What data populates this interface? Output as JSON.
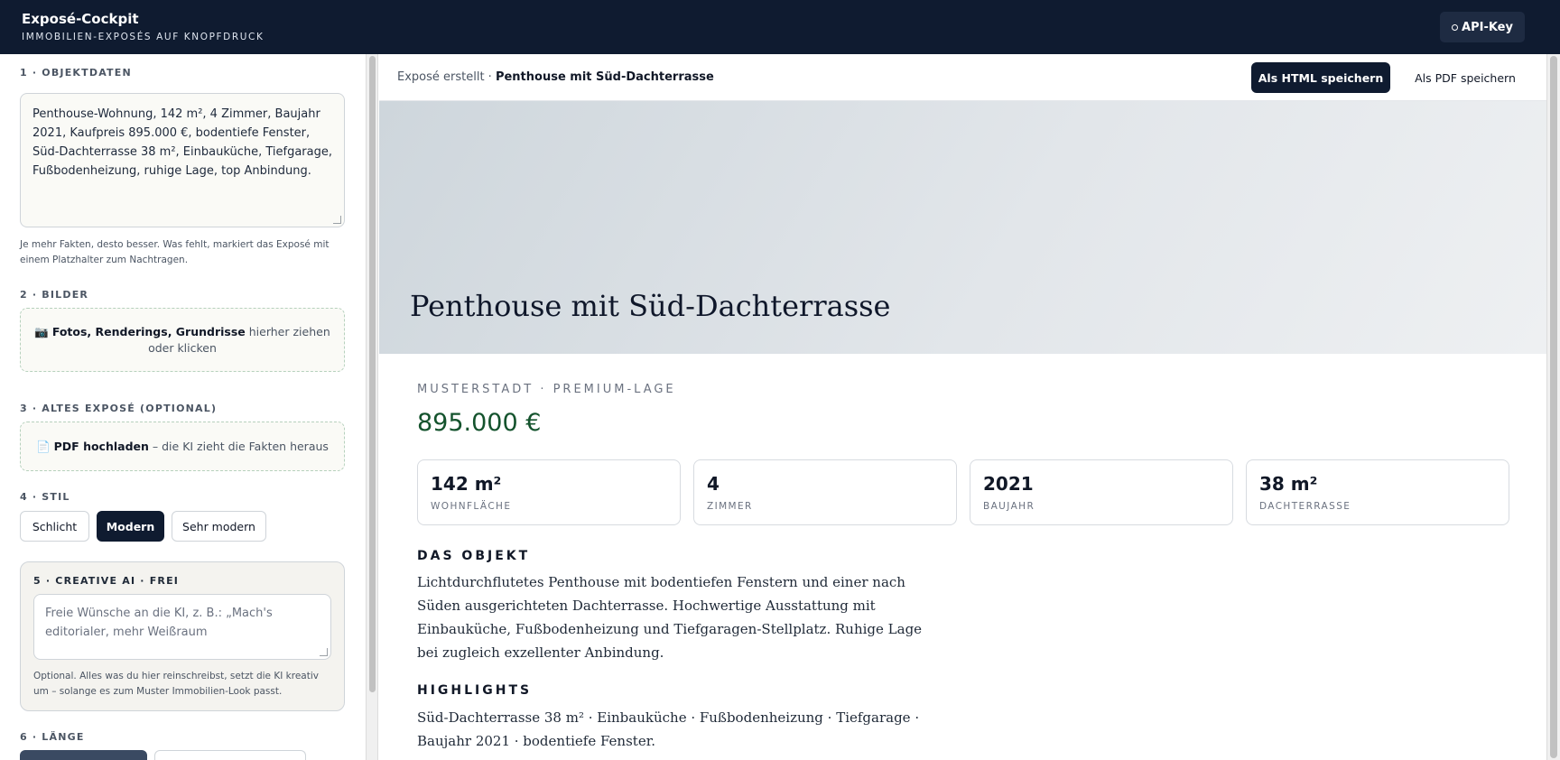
{
  "header": {
    "title": "Exposé-Cockpit",
    "subtitle": "IMMOBILIEN-EXPOSÉS AUF KNOPFDRUCK",
    "api_key_label": "API-Key"
  },
  "sidebar": {
    "section1": {
      "label": "1 · OBJEKTDATEN",
      "value": "Penthouse-Wohnung, 142 m², 4 Zimmer, Baujahr 2021, Kaufpreis 895.000 €, bodentiefe Fenster, Süd-Dachterrasse 38 m², Einbauküche, Tiefgarage, Fußbodenheizung, ruhige Lage, top Anbindung.",
      "hint": "Je mehr Fakten, desto besser. Was fehlt, markiert das Exposé mit einem Platzhalter zum Nachtragen."
    },
    "section2": {
      "label": "2 · BILDER",
      "drop_strong": "Fotos, Renderings, Grundrisse",
      "drop_rest": " hierher ziehen oder klicken"
    },
    "section3": {
      "label": "3 · ALTES EXPOSÉ (OPTIONAL)",
      "drop_strong": "PDF hochladen",
      "drop_rest": " – die KI zieht die Fakten heraus"
    },
    "section4": {
      "label": "4 · STIL",
      "options": [
        "Schlicht",
        "Modern",
        "Sehr modern"
      ],
      "selected": "Modern"
    },
    "section5": {
      "label": "5 · CREATIVE AI  ·  FREI",
      "placeholder": "Freie Wünsche an die KI, z. B.: „Mach's editorialer, mehr Weißraum",
      "hint": "Optional. Alles was du hier reinschreibst, setzt die KI kreativ um – solange es zum Muster Immobilien-Look passt."
    },
    "section6": {
      "label": "6 · LÄNGE"
    }
  },
  "preview": {
    "breadcrumb_prefix": "Exposé erstellt · ",
    "breadcrumb_title": "Penthouse mit Süd-Dachterrasse",
    "save_html_label": "Als HTML speichern",
    "save_pdf_label": "Als PDF speichern",
    "hero_title": "Penthouse mit Süd-Dachterrasse",
    "kicker": "MUSTERSTADT · PREMIUM-LAGE",
    "price": "895.000 €",
    "facts": [
      {
        "value": "142 m²",
        "label": "WOHNFLÄCHE"
      },
      {
        "value": "4",
        "label": "ZIMMER"
      },
      {
        "value": "2021",
        "label": "BAUJAHR"
      },
      {
        "value": "38 m²",
        "label": "DACHTERRASSE"
      }
    ],
    "object_heading": "DAS OBJEKT",
    "object_text": "Lichtdurchflutetes Penthouse mit bodentiefen Fenstern und einer nach Süden ausgerichteten Dachterrasse. Hochwertige Ausstattung mit Einbauküche, Fußbodenheizung und Tiefgaragen-Stellplatz. Ruhige Lage bei zugleich exzellenter Anbindung.",
    "highlights_heading": "HIGHLIGHTS",
    "highlights_text": "Süd-Dachterrasse 38 m² · Einbauküche · Fußbodenheizung · Tiefgarage · Baujahr 2021 · bodentiefe Fenster."
  },
  "icons": {
    "api_key": "gear-icon",
    "images_drop": "camera-icon",
    "pdf_drop": "document-icon"
  },
  "colors": {
    "navy": "#0f1b30",
    "price_green": "#14532d",
    "dropzone_border": "#b6d1bd"
  }
}
